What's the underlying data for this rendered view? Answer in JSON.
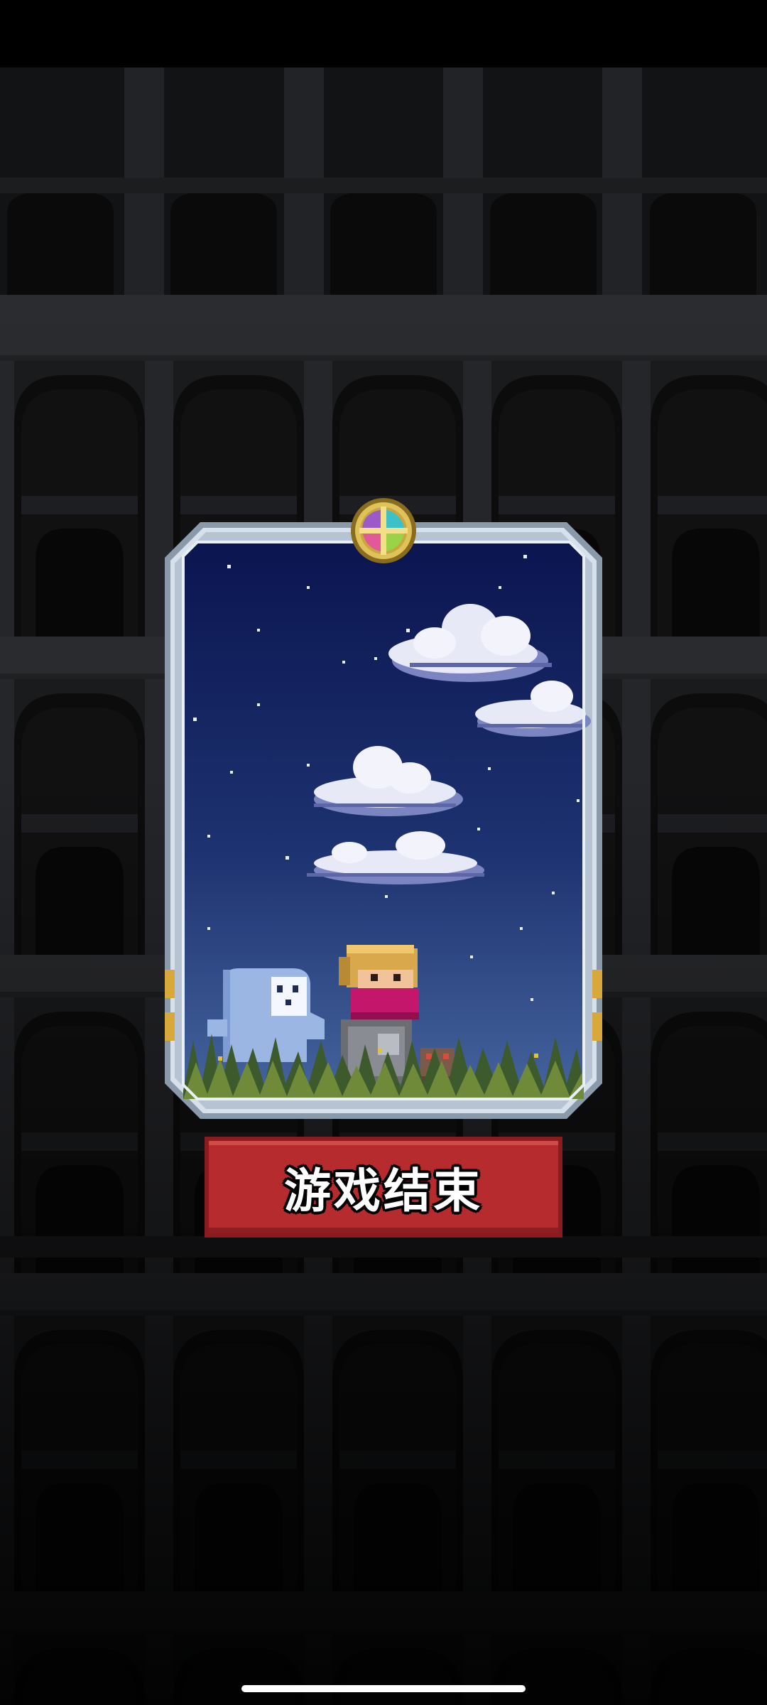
{
  "scene": {
    "background": "dark-stone-colosseum-arches",
    "colors": {
      "sky_top": "#0d1a55",
      "sky_bottom": "#3f5f9a",
      "frame": "#c9d6e3",
      "button": "#b52b2e",
      "ghost": "#9cb6e4",
      "scarf": "#c4176c"
    }
  },
  "card": {
    "emblem_icon": "four-color-cross-emblem-icon",
    "characters": [
      "ghost-sprite",
      "hero-sprite",
      "pet-sprite"
    ]
  },
  "game_over_button": {
    "label": "游戏结束"
  },
  "system": {
    "home_indicator": "home-indicator"
  }
}
